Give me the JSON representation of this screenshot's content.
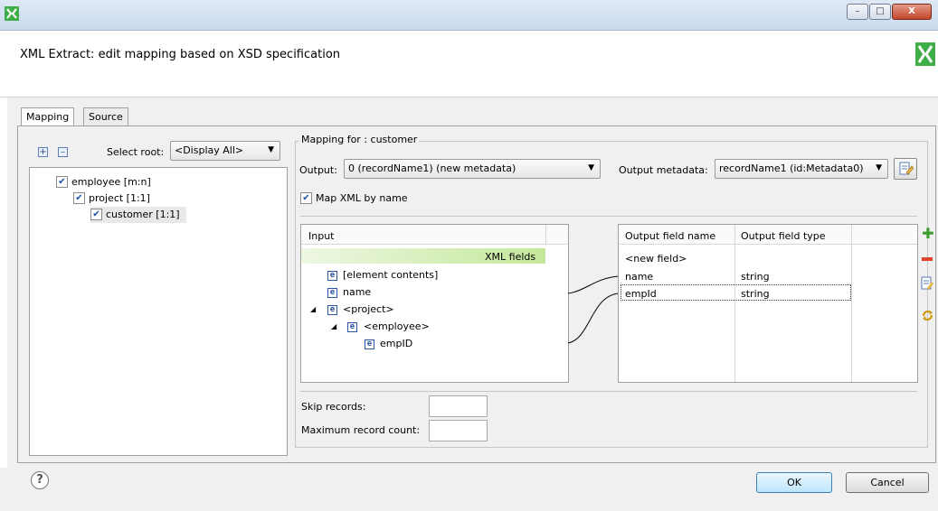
{
  "window": {
    "title": "",
    "minimize": "–",
    "maximize": "□",
    "close": "X"
  },
  "dialog": {
    "title": "XML Extract: edit mapping based on XSD specification"
  },
  "tabs": [
    {
      "label": "Mapping",
      "active": true
    },
    {
      "label": "Source",
      "active": false
    }
  ],
  "tree": {
    "expand_all": "+",
    "collapse_all": "–",
    "select_root_label": "Select root:",
    "select_root_value": "<Display All>",
    "items": [
      {
        "label": "employee [m:n]",
        "checked": true
      },
      {
        "label": "project [1:1]",
        "checked": true
      },
      {
        "label": "customer [1:1]",
        "checked": true
      }
    ]
  },
  "mapping": {
    "group_label": "Mapping for : customer",
    "output_label": "Output:",
    "output_value": "0 (recordName1) (new metadata)",
    "output_metadata_label": "Output metadata:",
    "output_metadata_value": "recordName1 (id:Metadata0)",
    "map_by_name_label": "Map XML by name",
    "map_by_name_checked": true
  },
  "input_table": {
    "header": "Input",
    "xml_fields_label": "XML fields",
    "rows": [
      {
        "icon": "e",
        "label": "[element contents]"
      },
      {
        "icon": "e",
        "label": "name"
      },
      {
        "icon": "e",
        "label": "<project>",
        "expander": "◢"
      },
      {
        "icon": "e",
        "label": "<employee>",
        "expander": "◢"
      },
      {
        "icon": "e",
        "label": "empID"
      }
    ]
  },
  "output_table": {
    "headers": [
      "Output field name",
      "Output field type"
    ],
    "rows": [
      {
        "name": "<new field>",
        "type": ""
      },
      {
        "name": "name",
        "type": "string"
      },
      {
        "name": "empId",
        "type": "string"
      }
    ]
  },
  "side_icons": [
    "plus-icon",
    "minus-icon",
    "edit-icon",
    "refresh-icon"
  ],
  "skip_records_label": "Skip records:",
  "skip_records_value": "",
  "max_record_label": "Maximum record count:",
  "max_record_value": "",
  "buttons": {
    "help": "?",
    "ok": "OK",
    "cancel": "Cancel"
  },
  "colors": {
    "brand": "#3fae49",
    "xml_fields_bg": "#c4e89a"
  }
}
